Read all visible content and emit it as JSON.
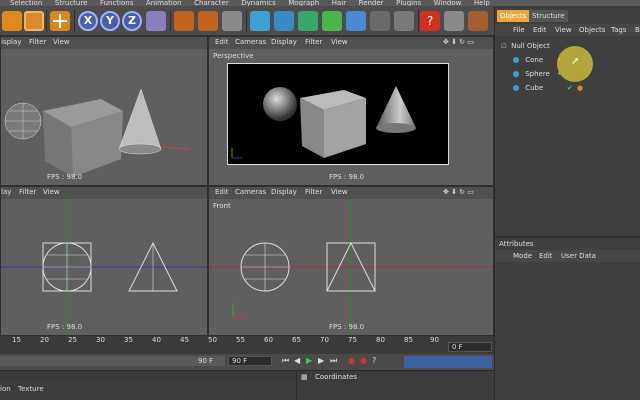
{
  "menubar": [
    "Selection",
    "Structure",
    "Functions",
    "Animation",
    "Character",
    "Dynamics",
    "Mograph",
    "Hair",
    "Render",
    "Plugins",
    "Window",
    "Help"
  ],
  "viewports": {
    "top_left": {
      "menu": [
        "isplay",
        "Filter",
        "View"
      ],
      "fps": "FPS : 98.0"
    },
    "perspective": {
      "menu": [
        "Edit",
        "Cameras",
        "Display",
        "Filter",
        "View"
      ],
      "title": "Perspective",
      "fps": "FPS : 98.0"
    },
    "bottom_left": {
      "menu": [
        "lay",
        "Filter",
        "View"
      ],
      "fps": "FPS : 98.0"
    },
    "front": {
      "menu": [
        "Edit",
        "Cameras",
        "Display",
        "Filter",
        "View"
      ],
      "title": "Front",
      "fps": "FPS : 98.0"
    }
  },
  "timeline": {
    "ticks": [
      "15",
      "20",
      "25",
      "30",
      "35",
      "40",
      "45",
      "50",
      "55",
      "60",
      "65",
      "70",
      "75",
      "80",
      "85",
      "90"
    ],
    "frame_field": "0 F",
    "current_frame": "90 F",
    "end_frame": "90 F"
  },
  "objects_panel": {
    "tabs": [
      "Objects",
      "Structure"
    ],
    "menu": [
      "File",
      "Edit",
      "View",
      "Objects",
      "Tags",
      "Bo"
    ],
    "items": [
      "Null Object",
      "Cone",
      "Sphere",
      "Cube"
    ]
  },
  "attributes_panel": {
    "title": "Attributes",
    "menu": [
      "Mode",
      "Edit",
      "User Data"
    ]
  },
  "bottom": {
    "left_tabs": [
      "ion",
      "Texture"
    ],
    "coordinates_title": "Coordinates"
  },
  "colors": {
    "accent_orange": "#e08a1e",
    "tab_active": "#e8a53a",
    "cursor_highlight": "#e6d23a"
  }
}
